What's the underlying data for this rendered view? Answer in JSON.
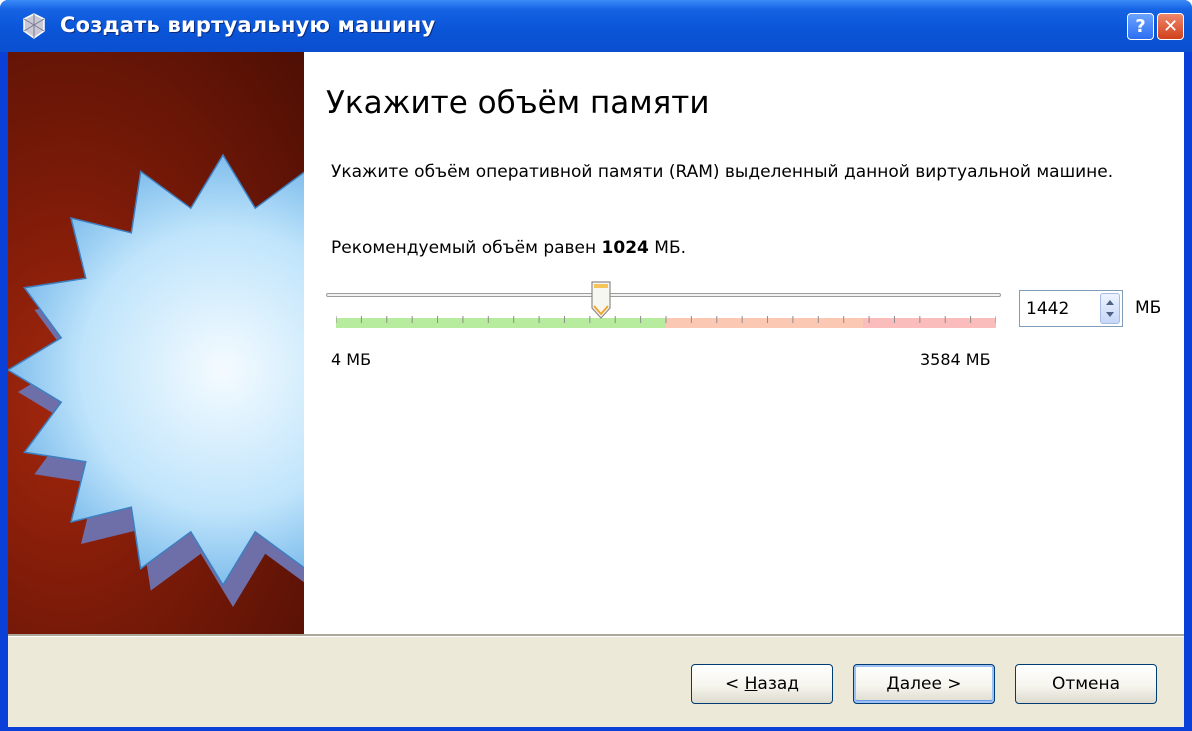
{
  "window": {
    "title": "Создать виртуальную машину",
    "help_label": "?",
    "close_label": "✕"
  },
  "page": {
    "title": "Укажите объём памяти",
    "description": "Укажите объём оперативной памяти (RAM) выделенный данной виртуальной машине.",
    "recommend_prefix": "Рекомендуемый объём равен",
    "recommend_value": "1024",
    "recommend_unit": "МБ."
  },
  "memory": {
    "min_label": "4 МБ",
    "max_label": "3584 МБ",
    "min_mb": 4,
    "max_mb": 3584,
    "value_mb": 1442,
    "value": "1442",
    "unit": "МБ",
    "green_until_mb": 1792,
    "orange_until_mb": 2860
  },
  "buttons": {
    "back_prefix": "< ",
    "back_accel": "Н",
    "back_rest": "азад",
    "next_accel": "Д",
    "next_rest": "алее >",
    "cancel": "Отмена"
  },
  "colors": {
    "titlebar": "#0a55d8",
    "green_zone": "#b7ec9e",
    "orange_zone": "#fbc9b3",
    "red_zone": "#fbbcbc"
  }
}
